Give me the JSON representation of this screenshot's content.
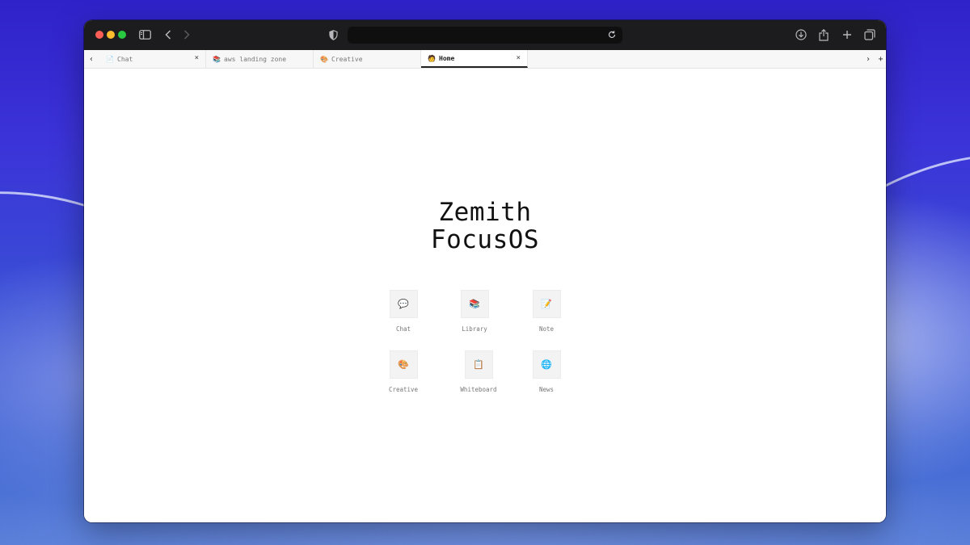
{
  "browser": {
    "address_text": "",
    "controls": [
      "sidebar-icon",
      "back-icon",
      "forward-icon",
      "shield-icon",
      "reload-icon",
      "download-icon",
      "share-icon",
      "new-tab-icon",
      "tab-overview-icon"
    ]
  },
  "tabs": [
    {
      "label": "Chat",
      "icon": "📄",
      "closable": true,
      "active": false
    },
    {
      "label": "aws landing zone",
      "icon": "📚",
      "closable": false,
      "active": false
    },
    {
      "label": "Creative",
      "icon": "🎨",
      "closable": false,
      "active": false
    },
    {
      "label": "Home",
      "icon": "🧑",
      "closable": true,
      "active": true
    }
  ],
  "tab_close_glyph": "×",
  "brand": {
    "line1": "Zemith",
    "line2": "FocusOS"
  },
  "apps": [
    {
      "label": "Chat",
      "icon": "💬"
    },
    {
      "label": "Library",
      "icon": "📚"
    },
    {
      "label": "Note",
      "icon": "📝"
    },
    {
      "label": "Creative",
      "icon": "🎨"
    },
    {
      "label": "Whiteboard",
      "icon": "📋"
    },
    {
      "label": "News",
      "icon": "🌐"
    }
  ],
  "colors": {
    "accent": "#222222",
    "toolbar": "#1c1c1e",
    "tile": "#f3f3f4"
  }
}
